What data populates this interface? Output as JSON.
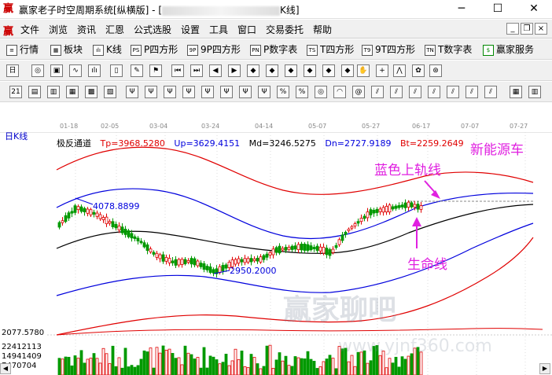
{
  "window": {
    "title_prefix": "赢家老子时空周期系统[纵横版] - [",
    "title_suffix": "K线]",
    "minimize": "─",
    "maximize": "☐",
    "close": "✕"
  },
  "menu": {
    "logo": "赢",
    "items": [
      "文件",
      "浏览",
      "资讯",
      "汇恩",
      "公式选股",
      "设置",
      "工具",
      "窗口",
      "交易委托",
      "帮助"
    ],
    "mdi_buttons": [
      "_",
      "❐",
      "×"
    ]
  },
  "toolbar1": {
    "items": [
      {
        "icon": "≡",
        "label": "行情"
      },
      {
        "icon": "▦",
        "label": "板块"
      },
      {
        "icon": "ılı",
        "label": "K线"
      },
      {
        "icon": "PS",
        "label": "P四方形"
      },
      {
        "icon": "9P",
        "label": "9P四方形"
      },
      {
        "icon": "PN",
        "label": "P数字表"
      },
      {
        "icon": "TS",
        "label": "T四方形"
      },
      {
        "icon": "T9",
        "label": "9T四方形"
      },
      {
        "icon": "TN",
        "label": "T数字表"
      },
      {
        "icon": "$",
        "label": "赢家服务"
      }
    ]
  },
  "time_axis": [
    "01-18",
    "02-05",
    "03-04",
    "03-24",
    "04-14",
    "05-07",
    "05-27",
    "06-17",
    "07-07",
    "07-27"
  ],
  "period": "日K线",
  "indicator": {
    "name": "极反通道",
    "tp": "Tp=3968.5280",
    "up": "Up=3629.4151",
    "md": "Md=3246.5275",
    "dn": "Dn=2727.9189",
    "bt": "Bt=2259.2649"
  },
  "price_labels": {
    "high": "4078.8899",
    "low": "2950.2000"
  },
  "annotations": {
    "stock": "新能源车",
    "blue_line": "蓝色上轨线",
    "life_line": "生命线"
  },
  "volume": {
    "axis_top": "2077.5780",
    "v1": "22412113",
    "v2": "14941409",
    "v3": "7470704"
  },
  "watermark": {
    "main": "赢家聊吧",
    "sub": "www.yjnf360.com"
  },
  "colors": {
    "red_line": "#e00000",
    "blue_line": "#0000dd",
    "black_line": "#000000",
    "up_candle": "#e00000",
    "down_candle": "#009900",
    "annotation": "#e020e0"
  }
}
